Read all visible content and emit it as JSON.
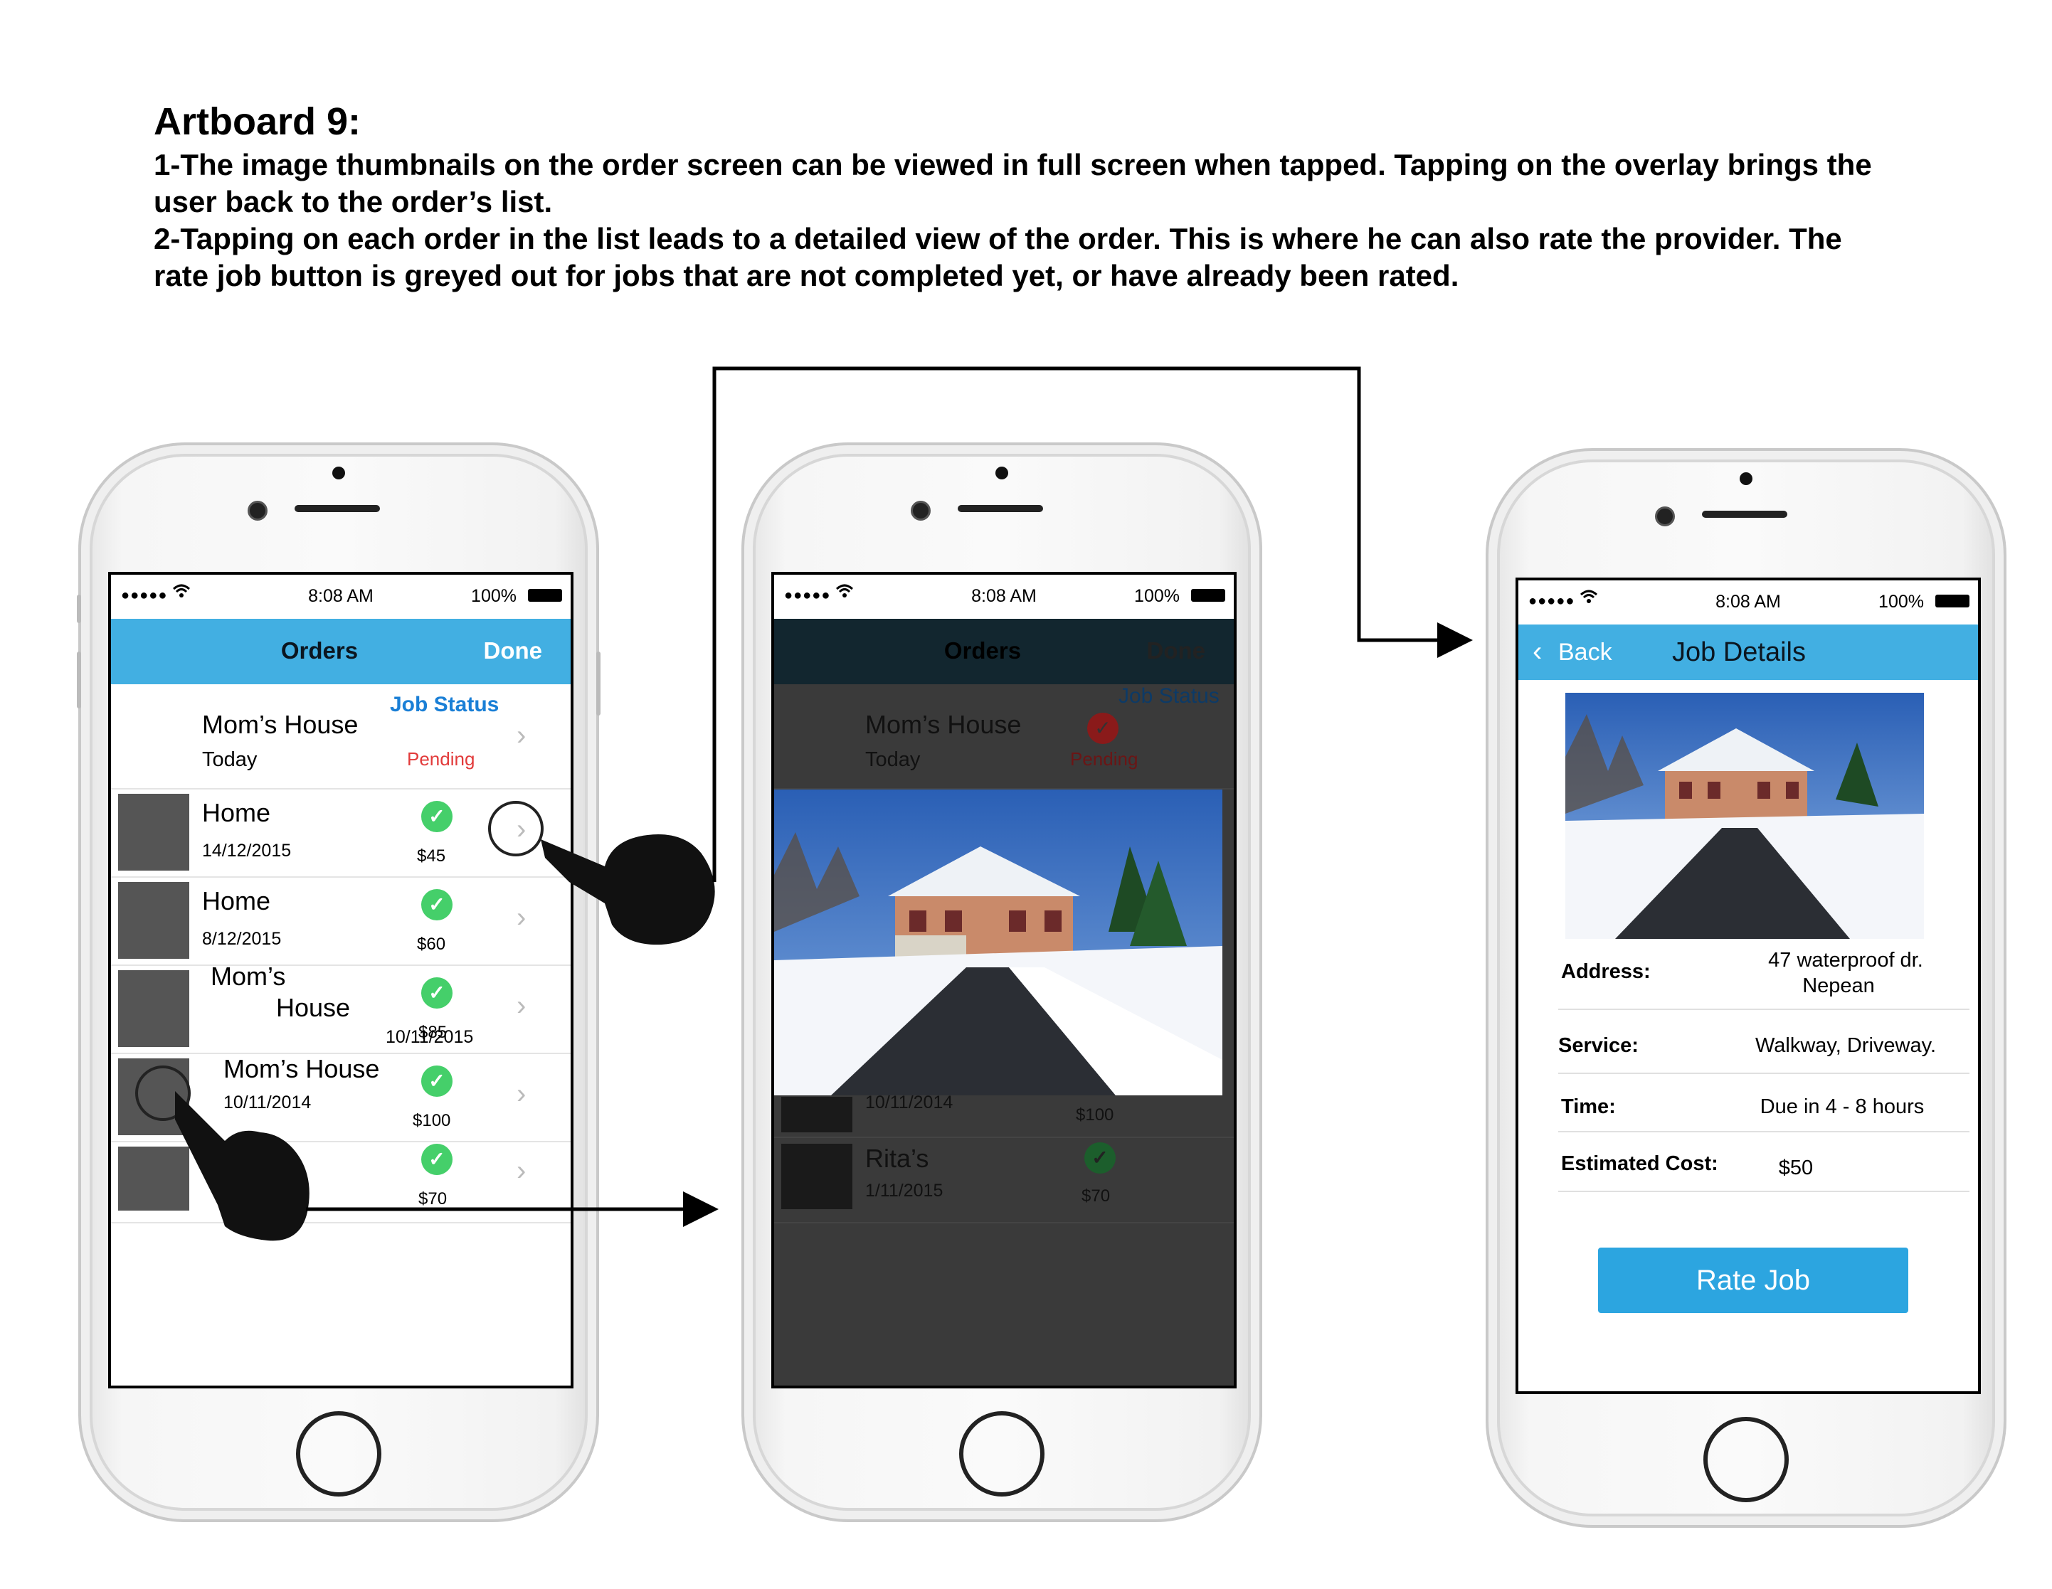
{
  "header": {
    "title": "Artboard 9:",
    "line1": "1-The image thumbnails on the order screen can be viewed in full screen when tapped. Tapping on the overlay brings the",
    "line2": "user back to the order’s list.",
    "line3": "2-Tapping on each order in the list leads to a detailed view of the order. This is where he can also rate the provider. The",
    "line4": "rate job button is greyed out for jobs that are not completed yet, or have already been rated."
  },
  "status_bar": {
    "signal": "●●●●●",
    "time": "8:08 AM",
    "battery": "100%"
  },
  "phone1": {
    "nav_title": "Orders",
    "done_label": "Done",
    "job_status_header": "Job Status",
    "first_order": {
      "name": "Mom’s House",
      "date": "Today",
      "status": "Pending"
    },
    "orders": [
      {
        "name": "Home",
        "date": "14/12/2015",
        "price": "$45"
      },
      {
        "name": "Home",
        "date": "8/12/2015",
        "price": "$60"
      },
      {
        "name": "Mom’s",
        "name2": "House",
        "date": "10/11/2015",
        "price": "$85"
      },
      {
        "name": "Mom’s House",
        "date": "10/11/2014",
        "price": "$100"
      },
      {
        "name": "",
        "date": "",
        "price": "$70"
      }
    ]
  },
  "phone2": {
    "nav_title": "Orders",
    "done_label": "Done",
    "job_status_header": "Job Status",
    "first_order": {
      "name": "Mom’s House",
      "date": "Today",
      "status": "Pending"
    },
    "partial_row": {
      "date": "10/11/2014",
      "price": "$100"
    },
    "last_row": {
      "name": "Rita’s",
      "date": "1/11/2015",
      "price": "$70"
    }
  },
  "phone3": {
    "back_label": "Back",
    "nav_title": "Job Details",
    "address_label": "Address:",
    "address_value_1": "47 waterproof dr.",
    "address_value_2": "Nepean",
    "service_label": "Service:",
    "service_value": "Walkway, Driveway.",
    "time_label": "Time:",
    "time_value": "Due in 4 - 8 hours",
    "cost_label": "Estimated Cost:",
    "cost_value": "$50",
    "rate_button": "Rate Job"
  },
  "colors": {
    "navbar": "#42afe2",
    "rate_button": "#2ca5e0",
    "check": "#45cf6a",
    "pending": "#e23b3b",
    "job_status": "#1a7fd6"
  },
  "icons": [
    "wifi-icon",
    "battery-icon",
    "chevron-right-icon",
    "check-icon",
    "back-chevron-icon",
    "hand-pointer-icon",
    "arrow-icon",
    "house-photo"
  ]
}
